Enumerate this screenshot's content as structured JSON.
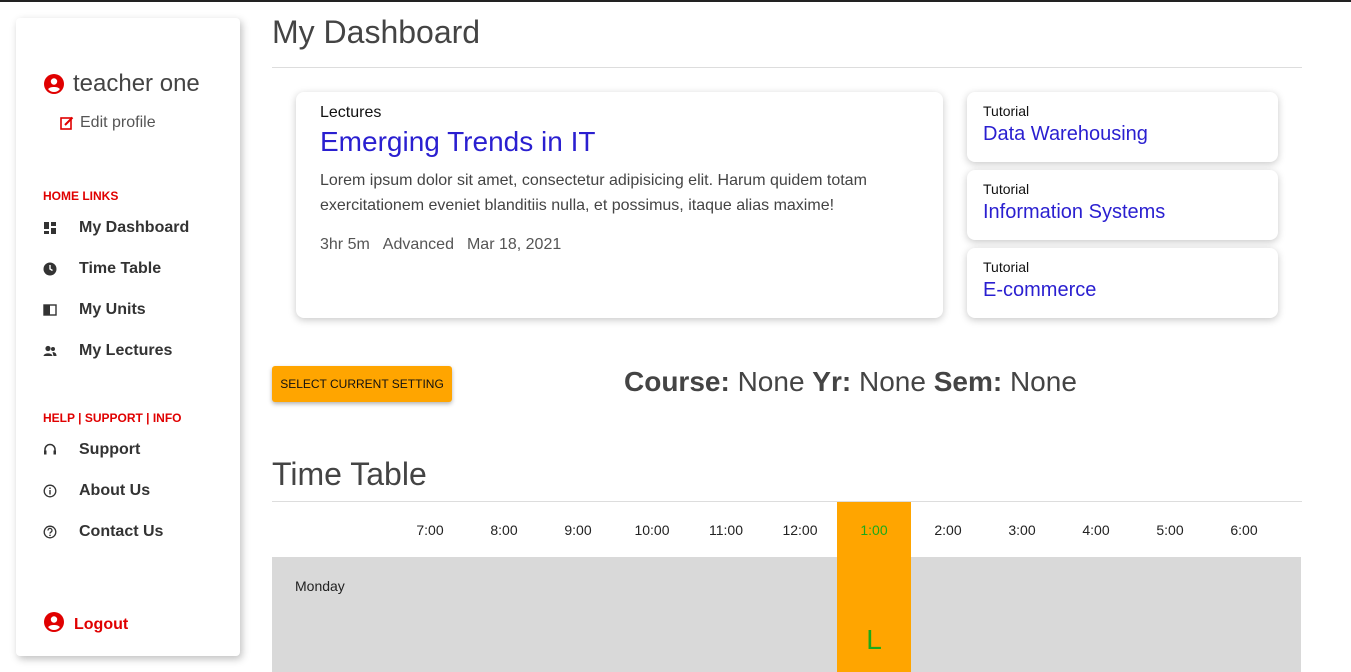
{
  "sidebar": {
    "user_name": "teacher one",
    "edit_profile": "Edit profile",
    "home_links_title": "HOME LINKS",
    "home_links": [
      {
        "label": "My Dashboard",
        "icon": "dashboard-icon"
      },
      {
        "label": "Time Table",
        "icon": "clock-icon"
      },
      {
        "label": "My Units",
        "icon": "book-icon"
      },
      {
        "label": "My Lectures",
        "icon": "people-icon"
      }
    ],
    "help_title": "HELP | SUPPORT | INFO",
    "help_links": [
      {
        "label": "Support",
        "icon": "headset-icon"
      },
      {
        "label": "About Us",
        "icon": "info-icon"
      },
      {
        "label": "Contact Us",
        "icon": "help-circle-icon"
      }
    ],
    "logout": "Logout"
  },
  "header": {
    "title": "My Dashboard"
  },
  "lecture": {
    "kind": "Lectures",
    "title": "Emerging Trends in IT",
    "description": "Lorem ipsum dolor sit amet, consectetur adipisicing elit. Harum quidem totam exercitationem eveniet blanditiis nulla, et possimus, itaque alias maxime!",
    "duration": "3hr 5m",
    "level": "Advanced",
    "date": "Mar 18, 2021"
  },
  "tutorials": [
    {
      "kind": "Tutorial",
      "title": "Data Warehousing"
    },
    {
      "kind": "Tutorial",
      "title": "Information Systems"
    },
    {
      "kind": "Tutorial",
      "title": "E-commerce"
    }
  ],
  "settings": {
    "button_label": "SELECT CURRENT SETTING",
    "course_label": "Course:",
    "course_value": "None",
    "year_label": "Yr:",
    "year_value": "None",
    "sem_label": "Sem:",
    "sem_value": "None"
  },
  "timetable": {
    "title": "Time Table",
    "hours": [
      "7:00",
      "8:00",
      "9:00",
      "10:00",
      "11:00",
      "12:00",
      "1:00",
      "2:00",
      "3:00",
      "4:00",
      "5:00",
      "6:00"
    ],
    "active_hour": "1:00",
    "rows": [
      {
        "day": "Monday",
        "slot_label": "L",
        "slot_hour": "1:00"
      }
    ]
  },
  "colors": {
    "accent": "#ffa500",
    "link": "#2a1fd0",
    "danger": "#e00000",
    "slot_text": "#1aaa1a"
  }
}
